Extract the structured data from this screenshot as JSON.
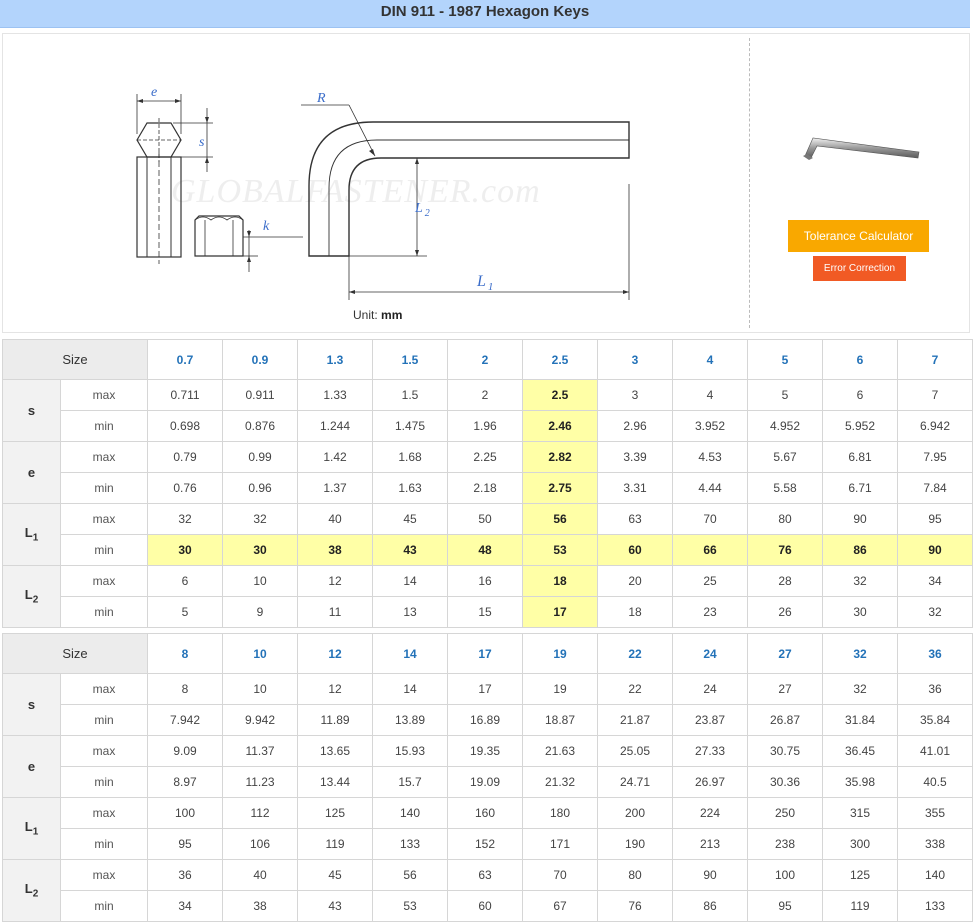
{
  "title": "DIN 911 - 1987 Hexagon Keys",
  "figure": {
    "labels": {
      "e": "e",
      "s": "s",
      "k": "k",
      "R": "R",
      "L2": "L",
      "L2_sub": "2",
      "L1": "L",
      "L1_sub": "1"
    },
    "watermark": "GLOBALFASTENER.com",
    "unit_label": "Unit:",
    "unit_value": "mm"
  },
  "buttons": {
    "tolerance": "Tolerance Calculator",
    "error": "Error Correction"
  },
  "table_labels": {
    "size": "Size",
    "max": "max",
    "min": "min",
    "s": "s",
    "e": "e",
    "L": "L",
    "sub1": "1",
    "sub2": "2"
  },
  "tables": [
    {
      "sizes": [
        "0.7",
        "0.9",
        "1.3",
        "1.5",
        "2",
        "2.5",
        "3",
        "4",
        "5",
        "6",
        "7"
      ],
      "s_max": [
        "0.711",
        "0.911",
        "1.33",
        "1.5",
        "2",
        "2.5",
        "3",
        "4",
        "5",
        "6",
        "7"
      ],
      "s_min": [
        "0.698",
        "0.876",
        "1.244",
        "1.475",
        "1.96",
        "2.46",
        "2.96",
        "3.952",
        "4.952",
        "5.952",
        "6.942"
      ],
      "e_max": [
        "0.79",
        "0.99",
        "1.42",
        "1.68",
        "2.25",
        "2.82",
        "3.39",
        "4.53",
        "5.67",
        "6.81",
        "7.95"
      ],
      "e_min": [
        "0.76",
        "0.96",
        "1.37",
        "1.63",
        "2.18",
        "2.75",
        "3.31",
        "4.44",
        "5.58",
        "6.71",
        "7.84"
      ],
      "L1_max": [
        "32",
        "32",
        "40",
        "45",
        "50",
        "56",
        "63",
        "70",
        "80",
        "90",
        "95"
      ],
      "L1_min": [
        "30",
        "30",
        "38",
        "43",
        "48",
        "53",
        "60",
        "66",
        "76",
        "86",
        "90"
      ],
      "L2_max": [
        "6",
        "10",
        "12",
        "14",
        "16",
        "18",
        "20",
        "25",
        "28",
        "32",
        "34"
      ],
      "L2_min": [
        "5",
        "9",
        "11",
        "13",
        "15",
        "17",
        "18",
        "23",
        "26",
        "30",
        "32"
      ]
    },
    {
      "sizes": [
        "8",
        "10",
        "12",
        "14",
        "17",
        "19",
        "22",
        "24",
        "27",
        "32",
        "36"
      ],
      "s_max": [
        "8",
        "10",
        "12",
        "14",
        "17",
        "19",
        "22",
        "24",
        "27",
        "32",
        "36"
      ],
      "s_min": [
        "7.942",
        "9.942",
        "11.89",
        "13.89",
        "16.89",
        "18.87",
        "21.87",
        "23.87",
        "26.87",
        "31.84",
        "35.84"
      ],
      "e_max": [
        "9.09",
        "11.37",
        "13.65",
        "15.93",
        "19.35",
        "21.63",
        "25.05",
        "27.33",
        "30.75",
        "36.45",
        "41.01"
      ],
      "e_min": [
        "8.97",
        "11.23",
        "13.44",
        "15.7",
        "19.09",
        "21.32",
        "24.71",
        "26.97",
        "30.36",
        "35.98",
        "40.5"
      ],
      "L1_max": [
        "100",
        "112",
        "125",
        "140",
        "160",
        "180",
        "200",
        "224",
        "250",
        "315",
        "355"
      ],
      "L1_min": [
        "95",
        "106",
        "119",
        "133",
        "152",
        "171",
        "190",
        "213",
        "238",
        "300",
        "338"
      ],
      "L2_max": [
        "36",
        "40",
        "45",
        "56",
        "63",
        "70",
        "80",
        "90",
        "100",
        "125",
        "140"
      ],
      "L2_min": [
        "34",
        "38",
        "43",
        "53",
        "60",
        "67",
        "76",
        "86",
        "95",
        "119",
        "133"
      ]
    }
  ],
  "highlight": {
    "column_table": 0,
    "column_index": 5,
    "row_table": 0,
    "row_key": "L1_min",
    "color": "#ffffa6"
  }
}
